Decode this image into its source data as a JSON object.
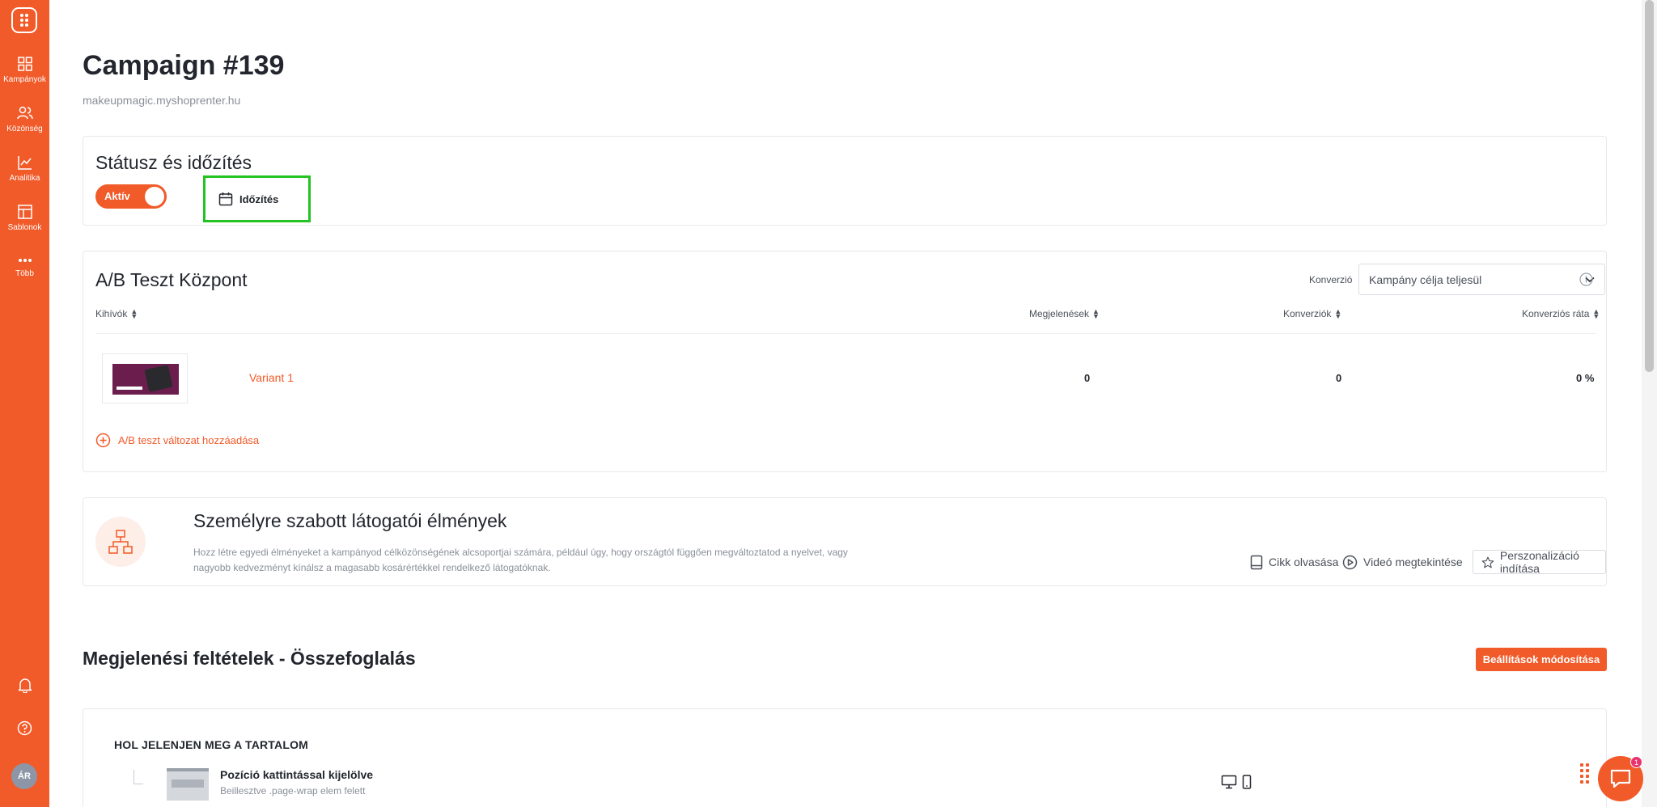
{
  "sidebar": {
    "items": [
      {
        "label": "Kampányok",
        "icon": "grid-icon"
      },
      {
        "label": "Közönség",
        "icon": "users-icon"
      },
      {
        "label": "Analitika",
        "icon": "chart-line-icon"
      },
      {
        "label": "Sablonok",
        "icon": "layout-icon"
      },
      {
        "label": "Több",
        "icon": "more-dots-icon"
      }
    ],
    "avatar_initials": "ÁR"
  },
  "page": {
    "title": "Campaign #139",
    "subtitle": "makeupmagic.myshoprenter.hu"
  },
  "status_card": {
    "title": "Státusz és időzítés",
    "toggle_label": "Aktív",
    "schedule_label": "Időzítés"
  },
  "ab_card": {
    "title": "A/B Teszt Központ",
    "conversion_label": "Konverzió",
    "conversion_select_value": "Kampány célja teljesül",
    "columns": {
      "challengers": "Kihívók",
      "impressions": "Megjelenések",
      "conversions": "Konverziók",
      "rate": "Konverziós ráta"
    },
    "rows": [
      {
        "name": "Variant 1",
        "impressions": "0",
        "conversions": "0",
        "rate": "0 %"
      }
    ],
    "add_variant_label": "A/B teszt változat hozzáadása"
  },
  "personalization_card": {
    "title": "Személyre szabott látogatói élmények",
    "description": "Hozz létre egyedi élményeket a kampányod célközönségének alcsoportjai számára, például úgy, hogy országtól függően megváltoztatod a nyelvet, vagy nagyobb kedvezményt kínálsz a magasabb kosárértékkel rendelkező látogatóknak.",
    "actions": {
      "read_article": "Cikk olvasása",
      "watch_video": "Videó megtekintése",
      "start_personalization": "Perszonalizáció indítása"
    }
  },
  "summary": {
    "title": "Megjelenési feltételek - Összefoglalás",
    "edit_button": "Beállítások módosítása",
    "where_title": "HOL JELENJEN MEG A TARTALOM",
    "position_title": "Pozíció kattintással kijelölve",
    "position_sub": "Beillesztve .page-wrap elem felett"
  },
  "chat": {
    "badge": "1"
  },
  "colors": {
    "brand": "#f15a29",
    "highlight": "#22c322"
  }
}
